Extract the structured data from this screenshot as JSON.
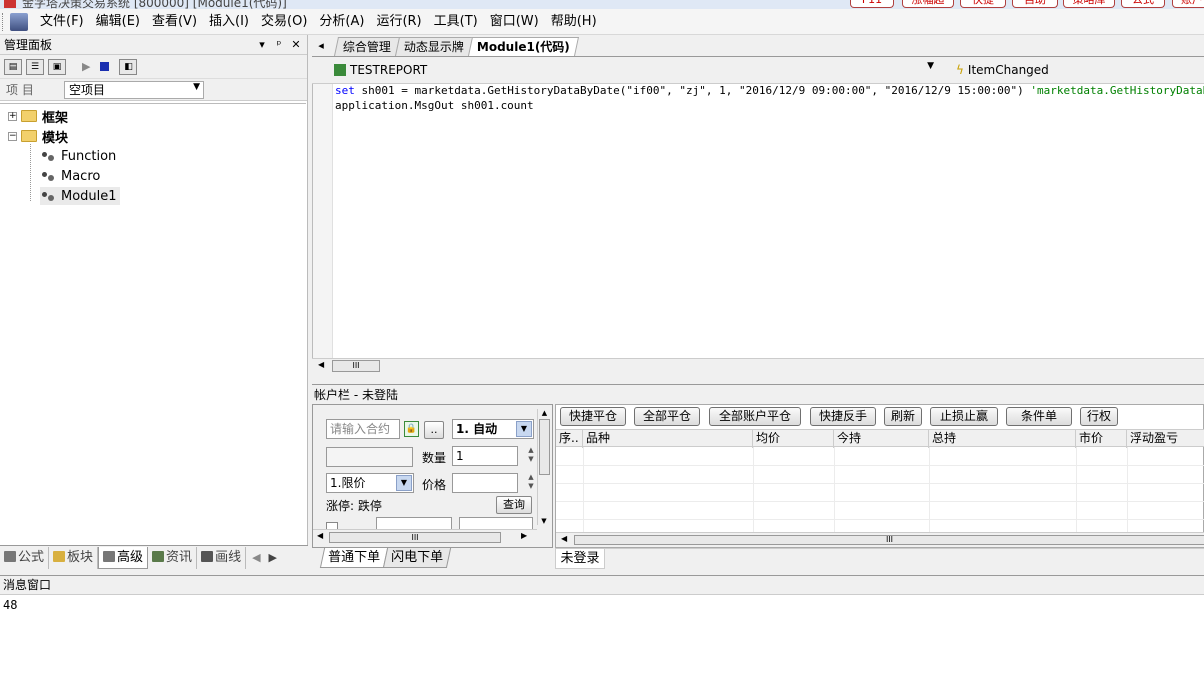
{
  "window": {
    "title": "金字塔决策交易系统 [800000] [Module1(代码)]",
    "top_buttons": [
      "F11",
      "涨幅超",
      "快捷",
      "自助",
      "策略库",
      "公式",
      "账户"
    ]
  },
  "menu": {
    "items": [
      "文件(F)",
      "编辑(E)",
      "查看(V)",
      "插入(I)",
      "交易(O)",
      "分析(A)",
      "运行(R)",
      "工具(T)",
      "窗口(W)",
      "帮助(H)"
    ]
  },
  "manage_panel": {
    "title": "管理面板",
    "pin": "ᵖ",
    "close": "✕",
    "dropdown": "▾",
    "project_label": "项 目",
    "project_value": "空项目",
    "tree": [
      {
        "label": "框架",
        "expander": "+"
      },
      {
        "label": "模块",
        "expander": "−"
      },
      {
        "label": "Function"
      },
      {
        "label": "Macro"
      },
      {
        "label": "Module1"
      }
    ]
  },
  "left_tabs": [
    "公式",
    "板块",
    "高级",
    "资讯",
    "画线"
  ],
  "editor": {
    "nav_left": "◂",
    "tabs": [
      "综合管理",
      "动态显示牌",
      "Module1(代码)"
    ],
    "object_combo": "TESTREPORT",
    "event_combo": "ItemChanged",
    "code": [
      {
        "kw": "set",
        "text": " sh001 = marketdata.GetHistoryDataByDate(\"if00\", \"zj\", 1, \"2016/12/9 09:00:00\", \"2016/12/9 15:00:00\") ",
        "comment": "'marketdata.GetHistoryDataByDate"
      },
      {
        "kw": "",
        "text": "application.MsgOut sh001.count",
        "comment": ""
      }
    ],
    "hscroll_grip": "III"
  },
  "account": {
    "header": "帐户栏 - 未登陆",
    "contract_placeholder": "请输入合约",
    "more_btn": "..",
    "auto_select": "1. 自动",
    "qty_label": "数量",
    "qty_value": "1",
    "price_type": "1.限价",
    "price_label": "价格",
    "limit_text": "涨停:  跌停",
    "query_btn": "查询",
    "hscroll_grip": "III",
    "buttons": [
      "快捷平仓",
      "全部平仓",
      "全部账户平仓",
      "快捷反手",
      "刷新",
      "止损止赢",
      "条件单",
      "行权"
    ],
    "columns": [
      "序..",
      "品种",
      "均价",
      "今持",
      "总持",
      "市价",
      "浮动盈亏"
    ],
    "order_tabs": [
      "普通下单",
      "闪电下单"
    ],
    "pos_tab": "未登录"
  },
  "message": {
    "title": "消息窗口",
    "output": "48"
  }
}
